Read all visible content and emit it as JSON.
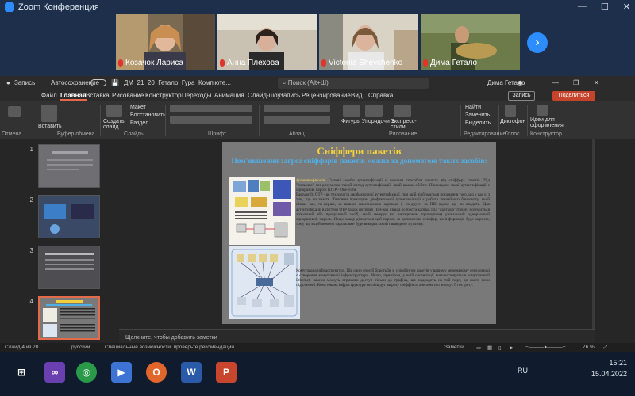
{
  "zoom": {
    "window_title": "Zoom Конференция",
    "participants": [
      {
        "name": "Козачок Лариса"
      },
      {
        "name": "Анна Плехова"
      },
      {
        "name": "Victoriia Shevchenko"
      },
      {
        "name": "Дима Гетало"
      }
    ],
    "next_icon": "chevron-right-icon"
  },
  "ppt": {
    "record_label": "Запись",
    "autosave_label": "Автосохранение",
    "file_name": "ДМ_21_20_Гетало_Гура_Комп'юте...",
    "search_placeholder": "Поиск (Alt+Ш)",
    "user_name": "Дима Гетало",
    "menu": [
      "Файл",
      "Главная",
      "Вставка",
      "Рисование",
      "Конструктор",
      "Переходы",
      "Анимация",
      "Слайд-шоу",
      "Запись",
      "Рецензирование",
      "Вид",
      "Справка"
    ],
    "active_menu": "Главная",
    "btn_record": "Запись",
    "btn_share": "Поделиться",
    "ribbon": {
      "paste": "Вставить",
      "create_slide": "Создать слайд",
      "layout": "Макет",
      "reset": "Восстановить",
      "section": "Раздел",
      "shapes": "Фигуры",
      "arrange": "Упорядочить",
      "express_styles": "Экспресс-стили",
      "find": "Найти",
      "replace": "Заменить",
      "select": "Выделить",
      "dictation": "Диктофон",
      "design_ideas": "Идеи для оформления",
      "groups": [
        "Отмена",
        "Буфер обмена",
        "Слайды",
        "Шрифт",
        "Абзац",
        "Рисование",
        "Редактирование",
        "Голос",
        "Конструктор"
      ]
    },
    "thumb_numbers": [
      "1",
      "2",
      "3",
      "4",
      "5"
    ],
    "selected_slide": "4",
    "slide": {
      "title": "Сніффери пакетів",
      "subtitle": "Пом'якшення загроз сніфферів пакетів можна за допомогою таких засобів:",
      "p1_hl": "Аутентифікація.",
      "p1": " Сильні засоби аутентифікації є першим способом захисту від сніффера пакетів. Під \"сильним\" ми розуміємо такий метод аутентифікації, який важко обійти. Прикладом такої аутентифікації є одноразові паролі (OTP - One-Time",
      "p2": "Password). OTP - це технологія двофакторної аутентифікації, при якій відбувається поєднання того, що у вас є, з тим, що ви знаєте. Типовим прикладом двофакторної аутентифікації є робота звичайного банкомату, який пізнає вас, по-перше, за вашою пластиковою карткою і, по-друге, за ПІН-кодом що ви вводите. Для аутентифікації в системі OTP також потрібні ПІН-код і ваша особиста картка. Під \"карткою\" (token) розуміється апаратний або програмний засіб, який генерує (за випадковим принципом) унікальний одноразовий одноразовий пароль. Якщо хакер дізнається цей пароль за допомогою сніффер, ця інформація буде марною, тому що в цей момент пароль вже буде використаний і виведено з ужитку.",
      "p3_hl": "Комутована інфраструктура.",
      "p3": " Ще один спосіб боротьби зі сніффінгом пакетів у вашому мережевому середовищі є створення комутованої інфраструктури. Якщо, приміром, у всій організації використовується комутований Ethernet, хакери можуть отримати доступ тільки до графіка, що надходить на той порт, до якого вони підключені. Комутована інфраструктура не ліквідує загрозу сніффінга, але помітно знижує її гостроту."
    },
    "notes_placeholder": "Щелкните, чтобы добавить заметки",
    "status": {
      "slide_counter": "Слайд 4 из 20",
      "language": "русский",
      "accessibility": "Специальные возможности: проверьте рекомендации",
      "notes": "Заметки",
      "zoom_pct": "76 %"
    }
  },
  "taskbar": {
    "language": "RU",
    "time": "15:21",
    "date": "15.04.2022"
  }
}
